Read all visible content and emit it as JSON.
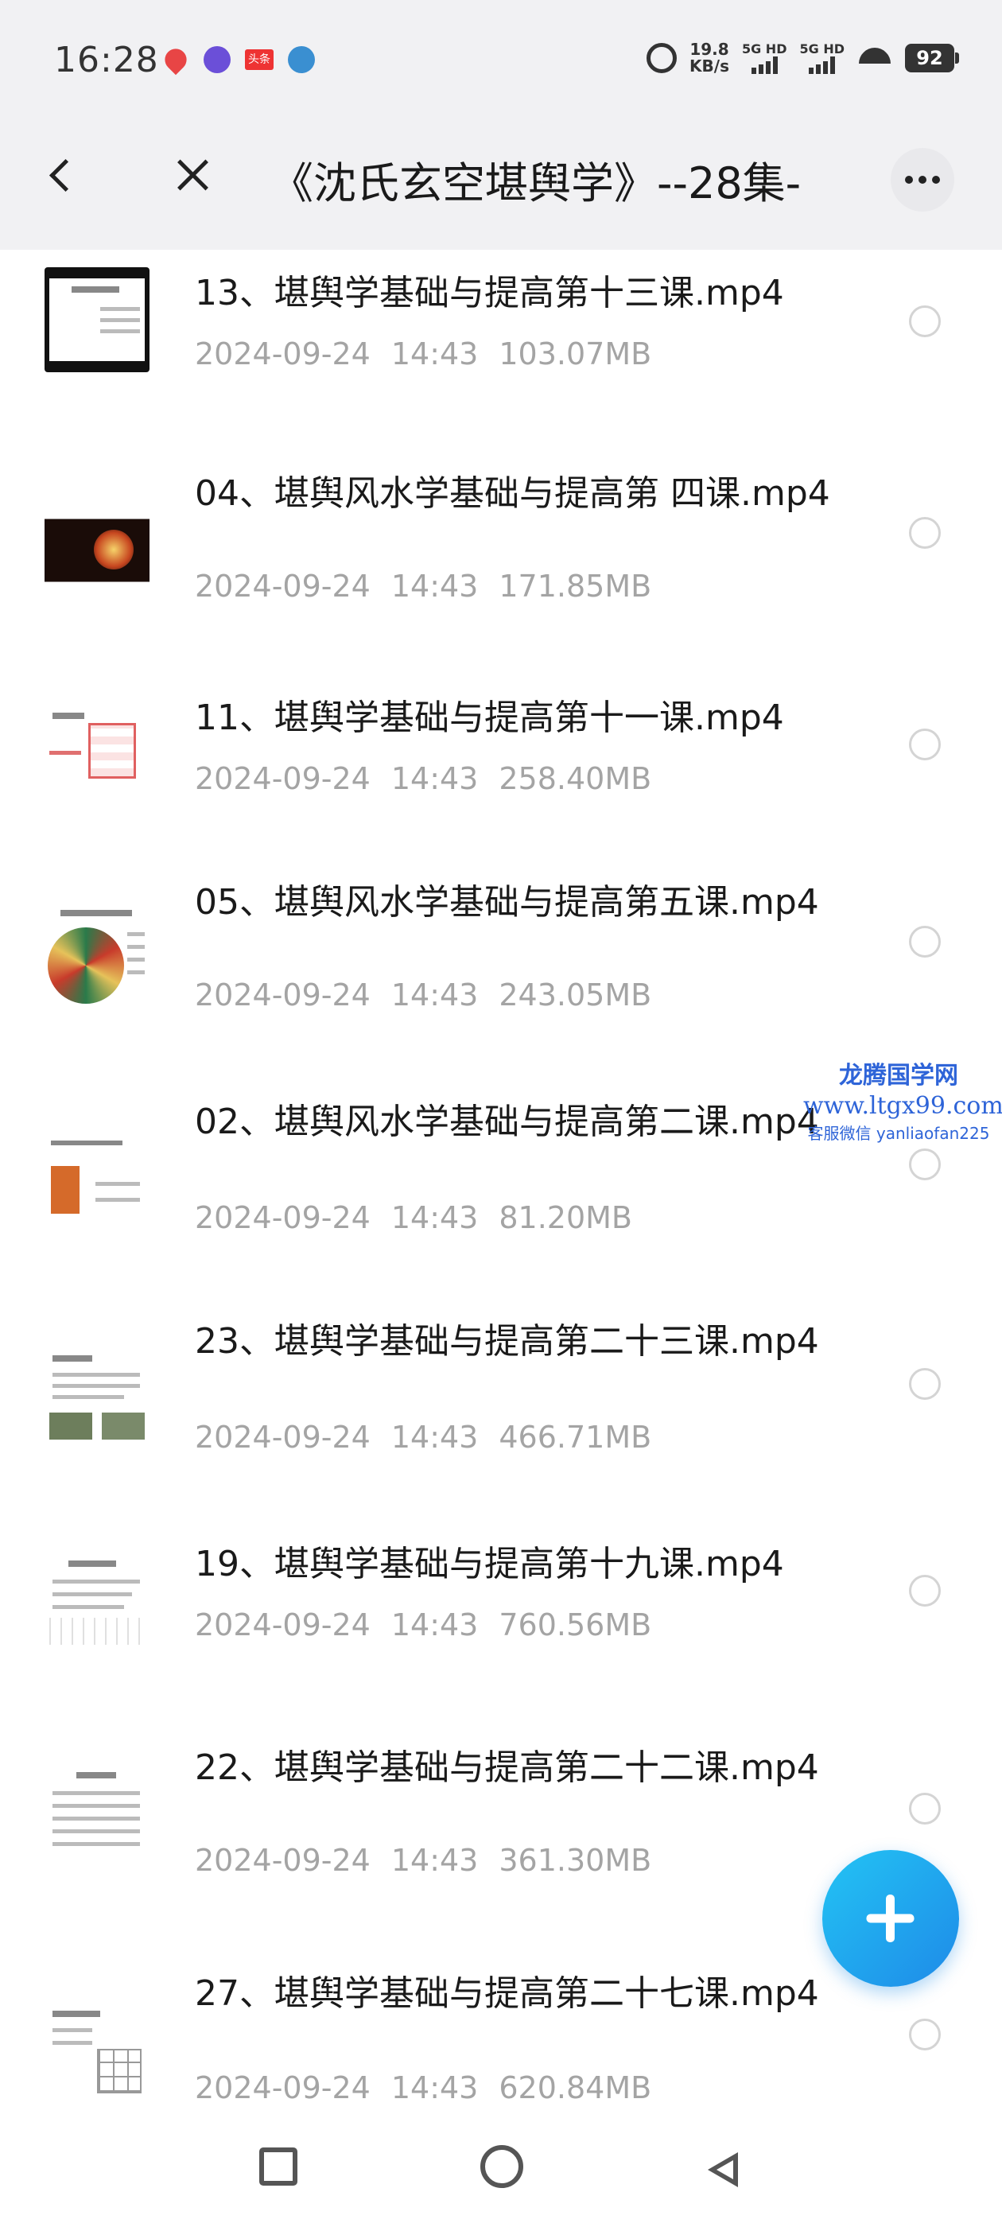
{
  "status_bar": {
    "time": "16:28",
    "net_speed_value": "19.8",
    "net_speed_unit": "KB/s",
    "sim1_label": "5G HD",
    "sim2_label": "5G HD",
    "battery": "92",
    "news_icon_label": "头条",
    "icons": [
      "map-pin-icon",
      "loop-app-icon",
      "news-app-icon",
      "bot-app-icon",
      "alarm-icon",
      "signal-icon",
      "wifi-icon",
      "battery-icon"
    ]
  },
  "header": {
    "title": "《沈氏玄空堪舆学》--28集-",
    "icons": [
      "back-icon",
      "close-icon",
      "more-icon"
    ]
  },
  "files": [
    {
      "name": "13、堪舆学基础与提高第十三课.mp4",
      "date": "2024-09-24",
      "time": "14:43",
      "size": "103.07MB"
    },
    {
      "name": "04、堪舆风水学基础与提高第 四课.mp4",
      "date": "2024-09-24",
      "time": "14:43",
      "size": "171.85MB"
    },
    {
      "name": "11、堪舆学基础与提高第十一课.mp4",
      "date": "2024-09-24",
      "time": "14:43",
      "size": "258.40MB"
    },
    {
      "name": "05、堪舆风水学基础与提高第五课.mp4",
      "date": "2024-09-24",
      "time": "14:43",
      "size": "243.05MB"
    },
    {
      "name": "02、堪舆风水学基础与提高第二课.mp4",
      "date": "2024-09-24",
      "time": "14:43",
      "size": "81.20MB"
    },
    {
      "name": "23、堪舆学基础与提高第二十三课.mp4",
      "date": "2024-09-24",
      "time": "14:43",
      "size": "466.71MB"
    },
    {
      "name": "19、堪舆学基础与提高第十九课.mp4",
      "date": "2024-09-24",
      "time": "14:43",
      "size": "760.56MB"
    },
    {
      "name": "22、堪舆学基础与提高第二十二课.mp4",
      "date": "2024-09-24",
      "time": "14:43",
      "size": "361.30MB"
    },
    {
      "name": "27、堪舆学基础与提高第二十七课.mp4",
      "date": "2024-09-24",
      "time": "14:43",
      "size": "620.84MB"
    }
  ],
  "watermark": {
    "name": "龙腾国学网",
    "url": "www.ltgx99.com",
    "contact": "客服微信 yanliaofan225"
  },
  "fab": {
    "icon": "plus-icon"
  },
  "nav": {
    "icons": [
      "recent-apps-icon",
      "home-icon",
      "back-triangle-icon"
    ]
  },
  "colors": {
    "accent": "#1e8ae8",
    "header_bg": "#f1f1f3",
    "meta_text": "#a4a4a4",
    "watermark": "#2e64d8"
  }
}
